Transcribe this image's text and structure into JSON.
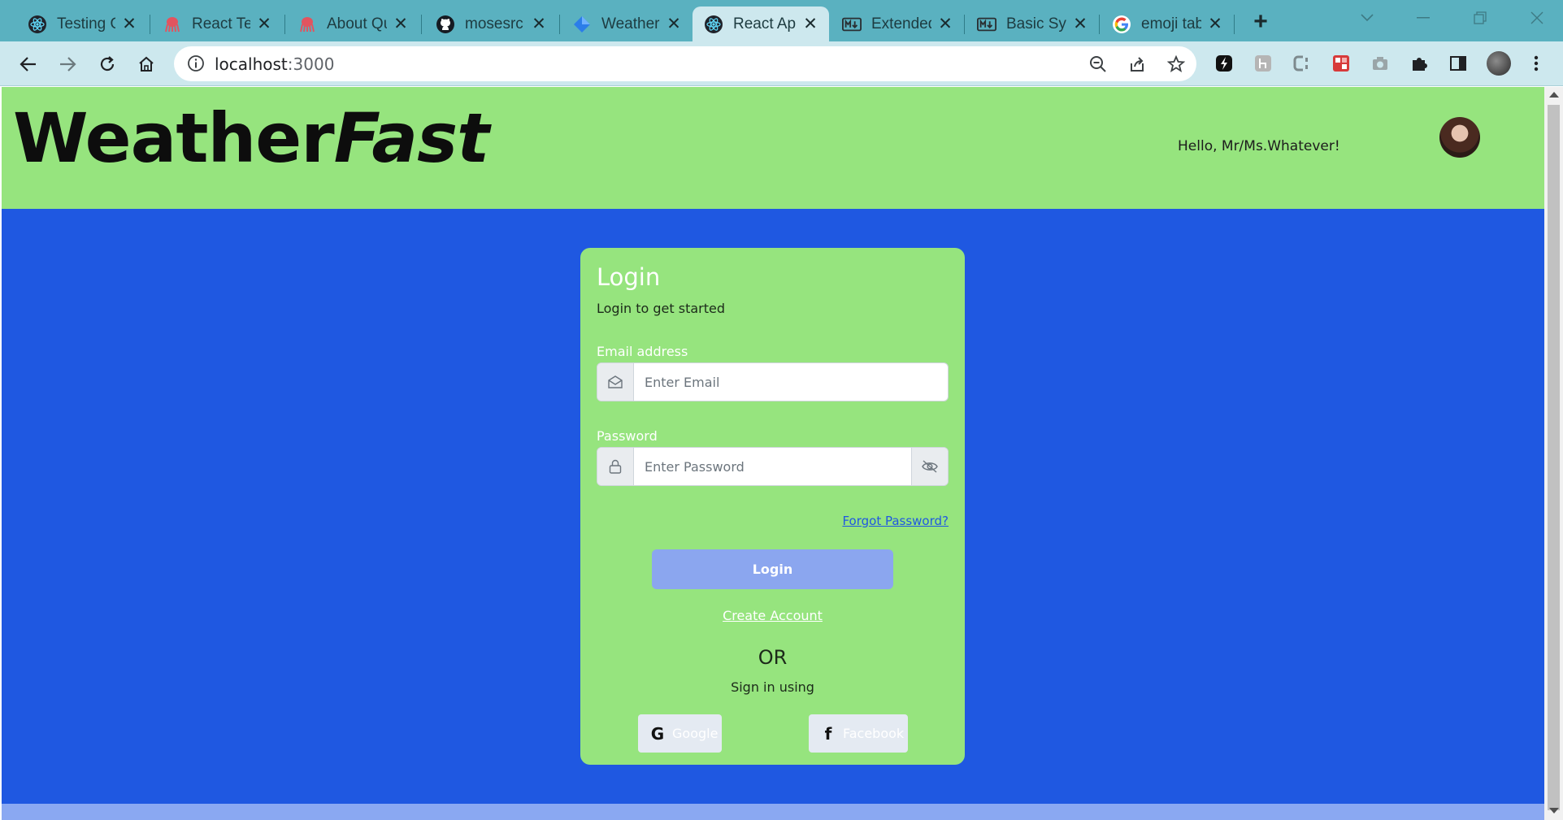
{
  "browser": {
    "tabs": [
      {
        "title": "Testing Ov",
        "icon": "react-icon",
        "active": false
      },
      {
        "title": "React Test",
        "icon": "octopus-icon",
        "active": false
      },
      {
        "title": "About Qu",
        "icon": "octopus-icon",
        "active": false
      },
      {
        "title": "mosesrc",
        "icon": "github-icon",
        "active": false
      },
      {
        "title": "Weather",
        "icon": "diamond-icon",
        "active": false
      },
      {
        "title": "React Ap",
        "icon": "react-icon",
        "active": true
      },
      {
        "title": "Extended",
        "icon": "markdown-icon",
        "active": false
      },
      {
        "title": "Basic Syn",
        "icon": "markdown-icon",
        "active": false
      },
      {
        "title": "emoji tab",
        "icon": "google-icon",
        "active": false
      }
    ],
    "url_host": "localhost",
    "url_port": ":3000",
    "accent": "#5ab1c0"
  },
  "header": {
    "brand_part1": "Weather",
    "brand_part2": "Fast",
    "greeting": "Hello, Mr/Ms.Whatever!",
    "background": "#96e47e"
  },
  "login": {
    "title": "Login",
    "subtitle": "Login to get started",
    "email_label": "Email address",
    "email_placeholder": "Enter Email",
    "password_label": "Password",
    "password_placeholder": "Enter Password",
    "forgot": "Forgot Password?",
    "button": "Login",
    "create_account": "Create Account",
    "or": "OR",
    "sign_in_using": "Sign in using",
    "google_icon": "G",
    "google": "Google",
    "facebook_icon": "f",
    "facebook": "Facebook"
  },
  "page_background": "#1f58e1"
}
